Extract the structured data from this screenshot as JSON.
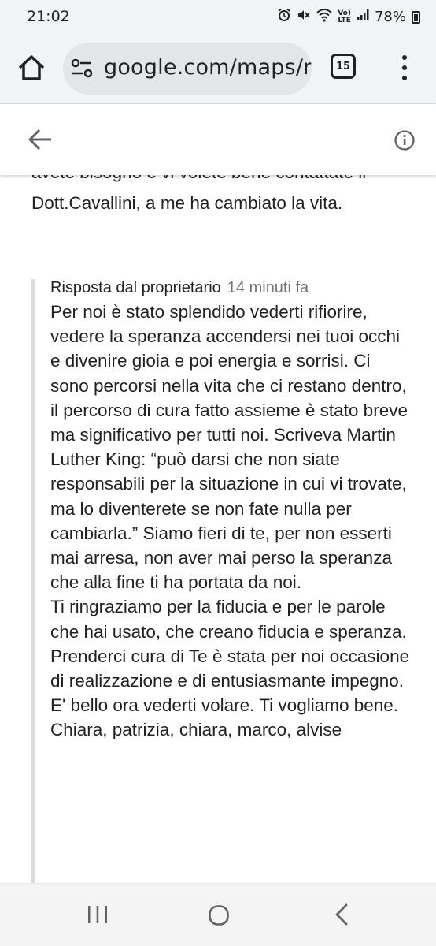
{
  "status_bar": {
    "time": "21:02",
    "battery_percent": "78%",
    "network_label": "LTE",
    "icons": [
      "alarm-icon",
      "mute-icon",
      "wifi-icon",
      "volte-icon",
      "signal-icon",
      "battery-icon"
    ]
  },
  "browser": {
    "url": "google.com/maps/re",
    "tab_count": "15"
  },
  "review": {
    "text_tail": "avete bisogno e vi volete bene contattate il Dott.Cavallini, a me ha cambiato la vita."
  },
  "reply": {
    "owner_label": "Risposta dal proprietario",
    "time": "14 minuti fa",
    "body": "Per noi è stato splendido vederti rifiorire, vedere la speranza accendersi nei tuoi occhi e divenire gioia e poi energia e sorrisi. Ci sono percorsi nella vita che ci restano dentro, il percorso di cura fatto assieme è stato breve ma significativo per tutti noi. Scriveva Martin Luther King: “può darsi che non siate responsabili per la situazione in cui vi trovate, ma lo diventerete se non fate nulla per cambiarla.” Siamo fieri di te, per non esserti mai arresa, non aver mai perso la speranza che alla fine ti ha portata da noi.\nTi ringraziamo per la fiducia e per le parole che hai usato, che creano fiducia e speranza. Prenderci cura di Te è stata per noi occasione di realizzazione e di entusiasmante impegno. E' bello ora vederti volare. Ti vogliamo bene.\nChiara, patrizia, chiara, marco, alvise"
  },
  "colors": {
    "chrome_bg": "#f1f3f4",
    "url_bg": "#e3e6e8",
    "text": "#202124",
    "muted": "#70757a",
    "reply_rule": "#dadce0"
  }
}
